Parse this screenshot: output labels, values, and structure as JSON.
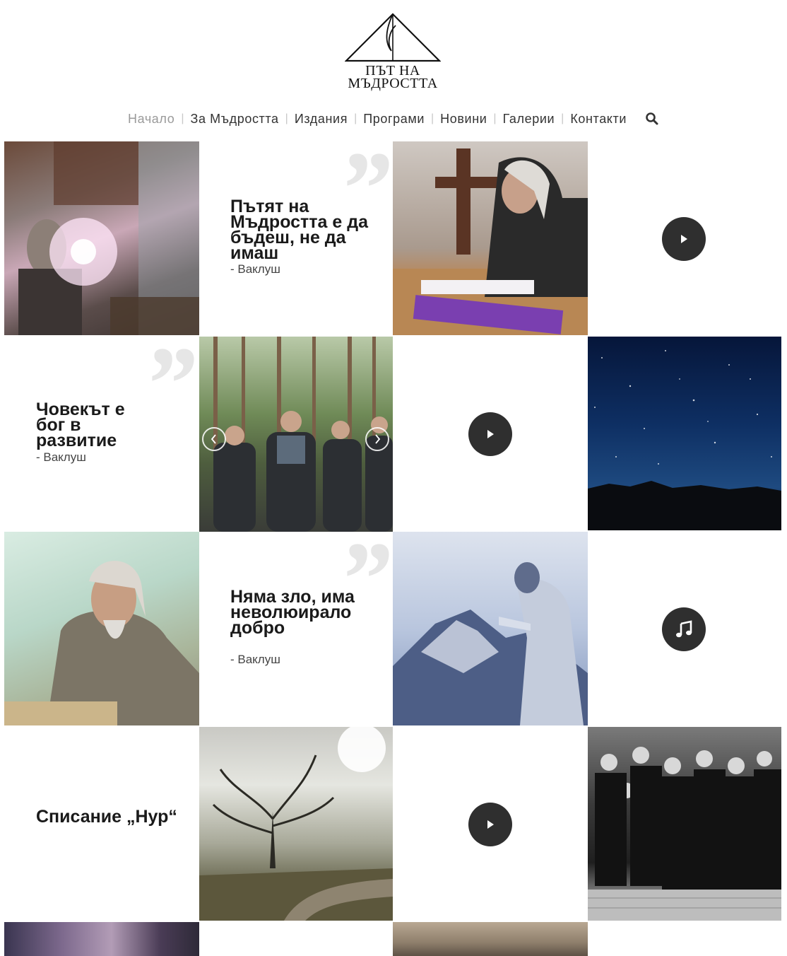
{
  "site": {
    "logo_line1": "ПЪТ НА",
    "logo_line2": "МЪДРОСТТА"
  },
  "nav": {
    "items": [
      {
        "label": "Начало",
        "active": true
      },
      {
        "label": "За Мъдростта"
      },
      {
        "label": "Издания"
      },
      {
        "label": "Програми"
      },
      {
        "label": "Новини"
      },
      {
        "label": "Галерии"
      },
      {
        "label": "Контакти"
      }
    ],
    "separator": "|",
    "search_icon": "search-icon"
  },
  "tiles": {
    "quote1": {
      "text": "Пътят на Мъдростта е да бъдеш, не да имаш",
      "author": "- Ваклуш"
    },
    "quote2": {
      "text": "Човекът е бог в развитие",
      "author": "- Ваклуш"
    },
    "quote3": {
      "text": "Няма зло, има неволюирало добро",
      "author": "- Ваклуш"
    },
    "magazine": {
      "text": "Списание „Нур“"
    },
    "quote_mark": "”"
  },
  "icons": {
    "play": "play-icon",
    "music": "music-note-icon",
    "prev": "chevron-left-icon",
    "next": "chevron-right-icon"
  },
  "colors": {
    "button_bg": "#2f2f2f",
    "nav_active": "#9a9a9a",
    "nav_text": "#333333",
    "quote_mark": "#e6e6e6"
  }
}
